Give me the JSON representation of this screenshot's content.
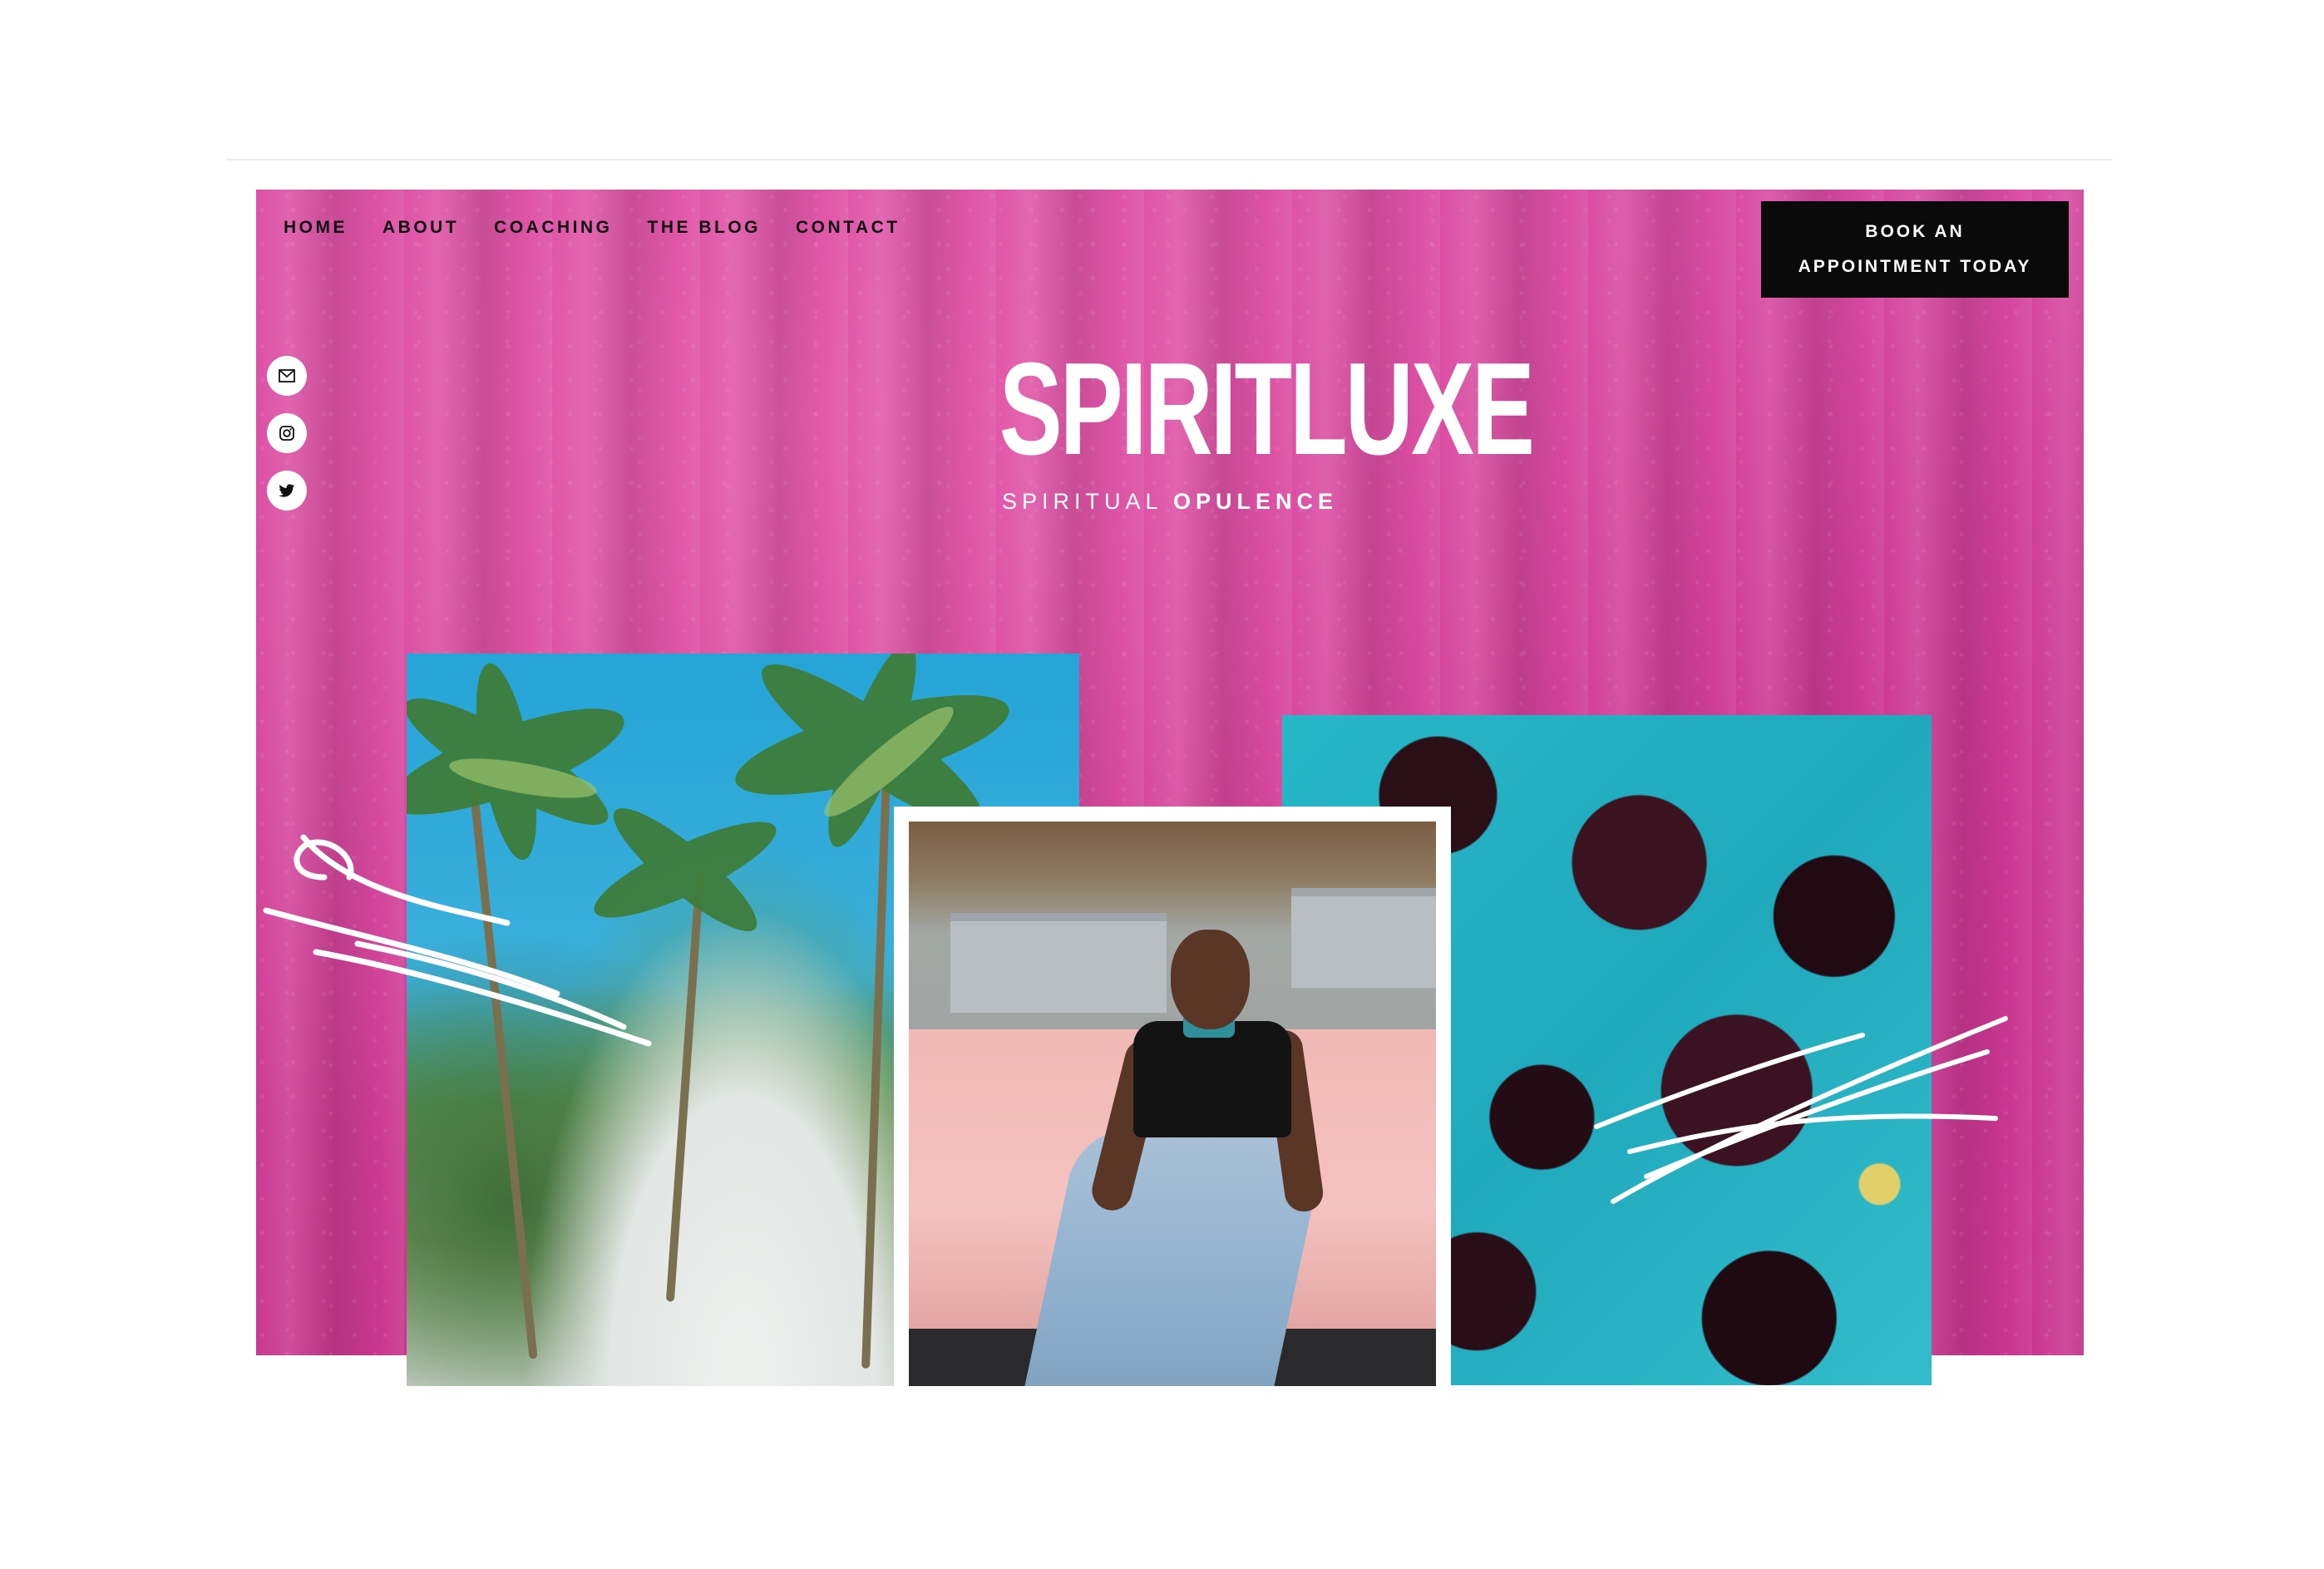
{
  "nav": {
    "items": [
      "HOME",
      "ABOUT",
      "COACHING",
      "THE BLOG",
      "CONTACT"
    ]
  },
  "cta": {
    "line1": "BOOK AN",
    "line2": "APPOINTMENT TODAY"
  },
  "social": {
    "icons": [
      "email-icon",
      "instagram-icon",
      "twitter-icon"
    ]
  },
  "brand": {
    "logo": "SPIRITLUXE",
    "tagline_regular": "SPIRITUAL",
    "tagline_bold": "OPULENCE"
  },
  "colors": {
    "hero_pink": "#d84aa2",
    "button_black": "#0a0a0a",
    "marble_teal": "#27b7c8"
  }
}
